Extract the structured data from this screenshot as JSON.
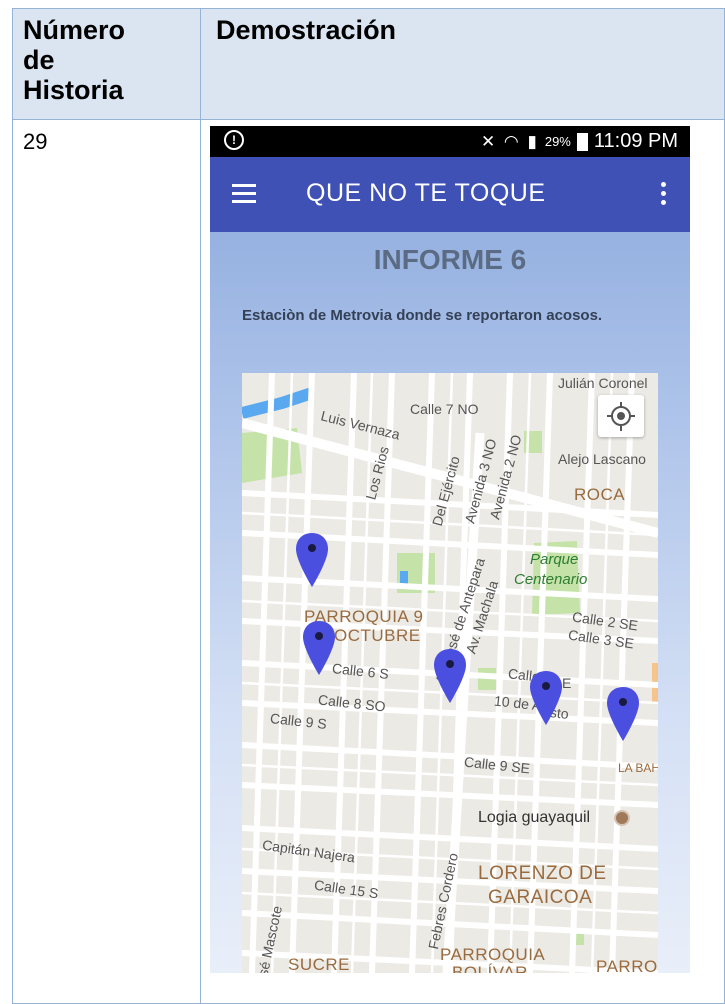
{
  "table": {
    "header_col1_lines": [
      "Número",
      "de",
      "Historia"
    ],
    "header_col2": "Demostración",
    "story_number": "29"
  },
  "statusbar": {
    "left_icon": "shield-icon",
    "icons": "wifi-icon signal-icon mute-icon",
    "battery": "29%",
    "time": "11:09 PM"
  },
  "appbar": {
    "title": "QUE NO TE TOQUE"
  },
  "report": {
    "title": "INFORME 6",
    "description": "Estaciòn de Metrovia donde se reportaron acosos."
  },
  "map": {
    "streets": {
      "julian_coronel": "Julián Coronel",
      "calle_7_no": "Calle 7 NO",
      "luis_vernaza": "Luis Vernaza",
      "los_rios": "Los Rios",
      "del_ejercito": "Del Ejército",
      "avenida_3_no": "Avenida 3 NO",
      "avenida_2_no": "Avenida 2 NO",
      "alejo_lascano": "Alejo Lascano",
      "calle_2_se": "Calle 2 SE",
      "calle_3_se": "Calle 3 SE",
      "av_jose_de_antepara": "Av. José de Antepara",
      "av_machala": "Av. Machala",
      "calle_6_s": "Calle 6 S",
      "calle_8_so": "Calle 8 SO",
      "calle_9_s": "Calle 9 S",
      "calle_fragment": "Calle",
      "e_fragment": "E",
      "diez_de_agosto_a": "10 de A",
      "diez_de_agosto_b": "sto",
      "calle_9_se": "Calle 9 SE",
      "capitan_najera": "Capitán Najera",
      "calle_15_s": "Calle 15 S",
      "febres_cordero": "Febres Cordero",
      "jose_mascote": "sé Mascote"
    },
    "areas": {
      "roca": "ROCA",
      "parroquia_9_octubre_a": "PARROQUIA 9",
      "parroquia_9_octubre_b": "OCTUBRE",
      "la_bahia": "LA BAH",
      "lorenzo_a": "LORENZO DE",
      "lorenzo_b": "GARAICOA",
      "parroquia_bolivar_a": "PARROQUIA",
      "parroquia_bolivar_b": "BOLÍVAR",
      "sucre": "SUCRE",
      "parroc": "PARROC"
    },
    "parks": {
      "parque_a": "Parque",
      "parque_b": "Centenario"
    },
    "pois": {
      "logia": "Logia guayaquil"
    },
    "marker_count": 5,
    "colors": {
      "marker": "#4b4fe0",
      "water": "#5aa8f0",
      "park": "#c5e3a8",
      "road": "#ffffff"
    }
  }
}
